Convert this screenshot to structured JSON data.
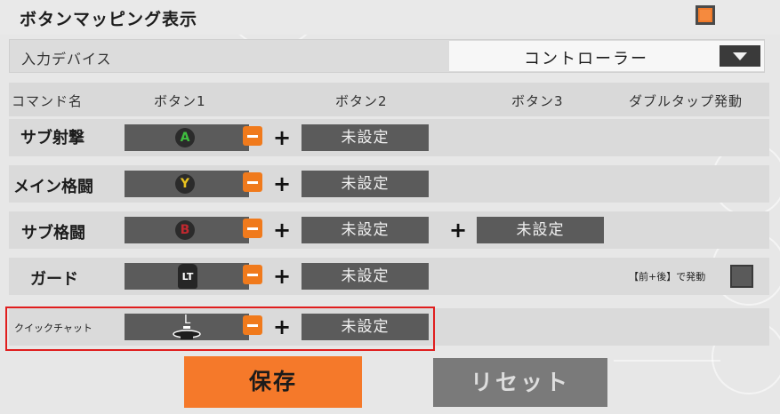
{
  "settings": {
    "mapping_display_label": "ボタンマッピング表示",
    "mapping_display_checked": true,
    "input_device_label": "入力デバイス",
    "input_device_value": "コントローラー"
  },
  "columns": [
    "コマンド名",
    "ボタン1",
    "ボタン2",
    "ボタン3",
    "ダブルタップ発動"
  ],
  "commands": [
    {
      "name": "サブ射撃",
      "button1_icon": "A",
      "button1_color": "#3fbf3f",
      "button2": "未設定"
    },
    {
      "name": "メイン格闘",
      "button1_icon": "Y",
      "button1_color": "#e8c21f",
      "button2": "未設定"
    },
    {
      "name": "サブ格闘",
      "button1_icon": "B",
      "button1_color": "#c0282f",
      "button2": "未設定",
      "button3": "未設定"
    },
    {
      "name": "ガード",
      "button1_icon": "LT",
      "button2": "未設定",
      "double_tap_label": "【前+後】で発動"
    },
    {
      "name": "クイックチャット",
      "button1_icon": "L",
      "button2": "未設定"
    }
  ],
  "actions": {
    "save": "保存",
    "reset": "リセット"
  },
  "colors": {
    "accent": "#f5792a",
    "highlight_border": "#e01e1e"
  }
}
